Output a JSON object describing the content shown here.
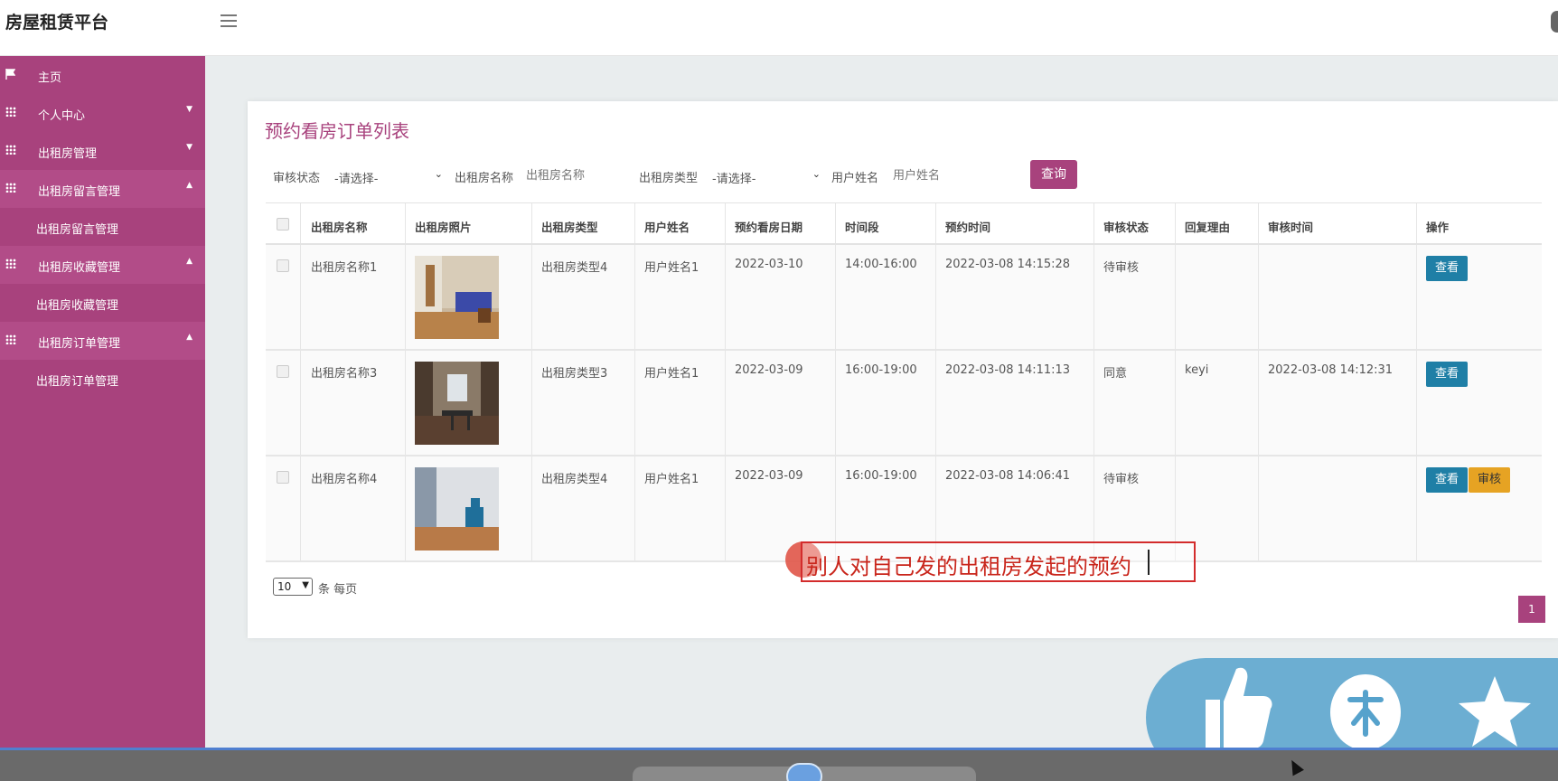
{
  "app": {
    "title": "房屋租赁平台"
  },
  "sidebar": {
    "items": [
      {
        "label": "主页",
        "icon": "flag-icon"
      },
      {
        "label": "个人中心",
        "icon": "grid-icon",
        "caret": "▼"
      },
      {
        "label": "出租房管理",
        "icon": "grid-icon",
        "caret": "▼"
      },
      {
        "label": "出租房留言管理",
        "icon": "grid-icon",
        "caret": "▲"
      },
      {
        "label": "出租房留言管理"
      },
      {
        "label": "出租房收藏管理",
        "icon": "grid-icon",
        "caret": "▲"
      },
      {
        "label": "出租房收藏管理"
      },
      {
        "label": "出租房订单管理",
        "icon": "grid-icon",
        "caret": "▲"
      },
      {
        "label": "出租房订单管理"
      }
    ]
  },
  "page": {
    "title": "预约看房订单列表"
  },
  "filters": {
    "status_label": "审核状态",
    "status_value": "-请选择-",
    "house_name_label": "出租房名称",
    "house_name_placeholder": "出租房名称",
    "house_type_label": "出租房类型",
    "house_type_value": "-请选择-",
    "user_name_label": "用户姓名",
    "user_name_placeholder": "用户姓名",
    "query_button": "查询"
  },
  "table": {
    "headers": [
      "出租房名称",
      "出租房照片",
      "出租房类型",
      "用户姓名",
      "预约看房日期",
      "时间段",
      "预约时间",
      "审核状态",
      "回复理由",
      "审核时间",
      "操作"
    ],
    "rows": [
      {
        "name": "出租房名称1",
        "photo": "bedroom-with-blue-bed",
        "type": "出租房类型4",
        "user": "用户姓名1",
        "date": "2022-03-10",
        "slot": "14:00-16:00",
        "time": "2022-03-08 14:15:28",
        "status": "待审核",
        "reply": "",
        "audit_time": "",
        "view": "查看"
      },
      {
        "name": "出租房名称3",
        "photo": "room-with-window",
        "type": "出租房类型3",
        "user": "用户姓名1",
        "date": "2022-03-09",
        "slot": "16:00-19:00",
        "time": "2022-03-08 14:11:13",
        "status": "同意",
        "reply": "keyi",
        "audit_time": "2022-03-08 14:12:31",
        "view": "查看"
      },
      {
        "name": "出租房名称4",
        "photo": "bright-room-with-chair",
        "type": "出租房类型4",
        "user": "用户姓名1",
        "date": "2022-03-09",
        "slot": "16:00-19:00",
        "time": "2022-03-08 14:06:41",
        "status": "待审核",
        "reply": "",
        "audit_time": "",
        "view": "查看",
        "audit": "审核"
      }
    ]
  },
  "pagination": {
    "page_size": "10",
    "page_size_label": "条 每页",
    "current_page": "1"
  },
  "annotation": {
    "text": "别人对自己发的出租房发起的预约"
  },
  "overlay": {
    "icons": [
      "thumbs-up-icon",
      "coin-icon",
      "star-icon"
    ]
  },
  "colors": {
    "brand": "#a8427d",
    "view_button": "#1f7fa6",
    "audit_button": "#e6a323"
  }
}
